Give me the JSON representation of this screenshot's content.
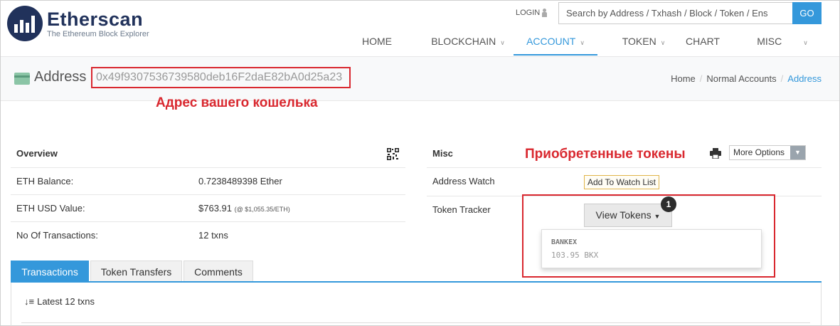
{
  "header": {
    "logo_name": "Etherscan",
    "logo_sub": "The Ethereum Block Explorer",
    "login": "LOGIN",
    "search_placeholder": "Search by Address / Txhash / Block / Token / Ens",
    "go": "GO"
  },
  "nav": [
    {
      "label": "HOME",
      "dropdown": false,
      "active": false
    },
    {
      "label": "BLOCKCHAIN",
      "dropdown": true,
      "active": false
    },
    {
      "label": "ACCOUNT",
      "dropdown": true,
      "active": true
    },
    {
      "label": "TOKEN",
      "dropdown": true,
      "active": false
    },
    {
      "label": "CHART",
      "dropdown": false,
      "active": false
    },
    {
      "label": "MISC",
      "dropdown": true,
      "active": false
    }
  ],
  "address": {
    "label": "Address",
    "value": "0x49f9307536739580deb16F2daE82bA0d25a23"
  },
  "breadcrumb": [
    "Home",
    "Normal Accounts",
    "Address"
  ],
  "annotations": {
    "wallet_address": "Адрес вашего кошелька",
    "tokens": "Приобретенные токены"
  },
  "overview": {
    "title": "Overview",
    "rows": [
      {
        "label": "ETH Balance:",
        "value": "0.7238489398 Ether",
        "note": ""
      },
      {
        "label": "ETH USD Value:",
        "value": "$763.91",
        "note": "(@ $1,055.35/ETH)"
      },
      {
        "label": "No Of Transactions:",
        "value": "12 txns",
        "note": ""
      }
    ]
  },
  "misc": {
    "title": "Misc",
    "more_options": "More Options",
    "address_watch": "Address Watch",
    "add_watch": "Add To Watch List",
    "token_tracker": "Token Tracker",
    "view_tokens": "View Tokens",
    "badge": "1",
    "token": {
      "name": "BANKEX",
      "amount": "103.95 BKX"
    }
  },
  "tabs": [
    {
      "label": "Transactions",
      "active": true
    },
    {
      "label": "Token Transfers",
      "active": false
    },
    {
      "label": "Comments",
      "active": false
    }
  ],
  "latest": "Latest 12 txns",
  "colors": {
    "accent": "#3498db",
    "annotation": "#d9282f",
    "brand": "#21325b"
  }
}
